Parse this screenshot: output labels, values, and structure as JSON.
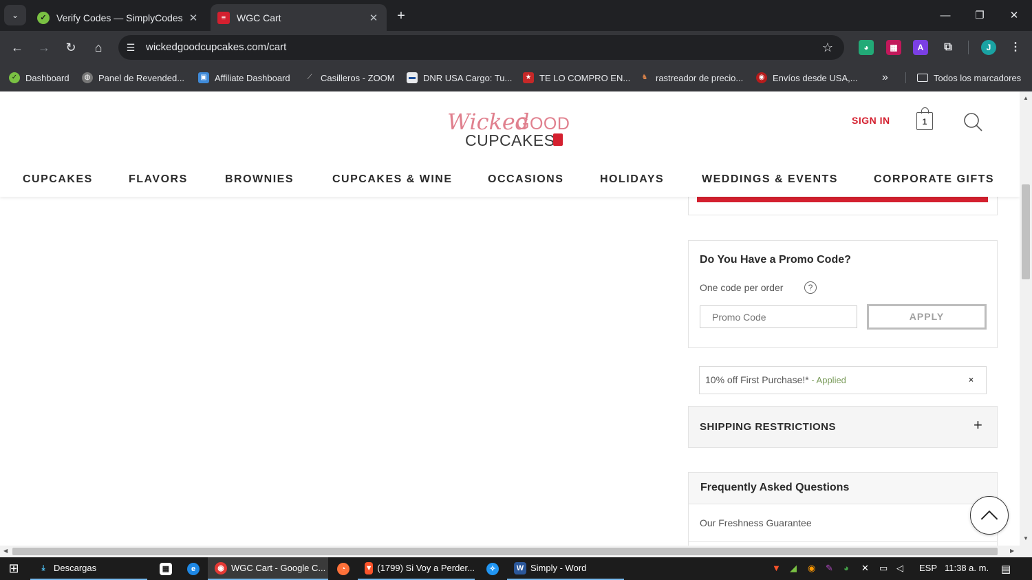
{
  "browser": {
    "tabs": [
      {
        "title": "Verify Codes — SimplyCodes",
        "active": false
      },
      {
        "title": "WGC Cart",
        "active": true
      }
    ],
    "url": "wickedgoodcupcakes.com/cart",
    "profile_initial": "J",
    "bookmarks": [
      "Dashboard",
      "Panel de Revended...",
      "Affiliate Dashboard",
      "Casilleros - ZOOM",
      "DNR USA Cargo: Tu...",
      "TE LO COMPRO EN...",
      "rastreador de precio...",
      "Envíos desde USA,..."
    ],
    "all_bookmarks": "Todos los marcadores",
    "overflow": "»"
  },
  "site": {
    "logo": {
      "wicked": "Wicked",
      "good": "GOOD",
      "cupcakes": "CUPCAKES"
    },
    "signin": "SIGN IN",
    "cart_count": "1",
    "nav": [
      "CUPCAKES",
      "FLAVORS",
      "BROWNIES",
      "CUPCAKES & WINE",
      "OCCASIONS",
      "HOLIDAYS",
      "WEDDINGS & EVENTS",
      "CORPORATE GIFTS"
    ]
  },
  "promo": {
    "title": "Do You Have a Promo Code?",
    "subtitle": "One code per order",
    "help": "?",
    "placeholder": "Promo Code",
    "apply_label": "APPLY",
    "applied_code": "10% off First Purchase!*",
    "applied_sep": " - ",
    "applied_status": "Applied",
    "remove": "×"
  },
  "shipping": {
    "title": "SHIPPING RESTRICTIONS",
    "toggle": "+"
  },
  "faq": {
    "title": "Frequently Asked Questions",
    "items": [
      "Our Freshness Guarantee"
    ]
  },
  "taskbar": {
    "items": [
      "Descargas",
      "WGC Cart - Google C...",
      "(1799) Si Voy a Perder...",
      "Simply - Word"
    ],
    "lang": "ESP",
    "time": "11:38 a. m."
  },
  "colors": {
    "brand_red": "#d4202f",
    "brand_pink": "#e0808e",
    "chrome_dark": "#202124",
    "chrome_toolbar": "#35363a"
  }
}
